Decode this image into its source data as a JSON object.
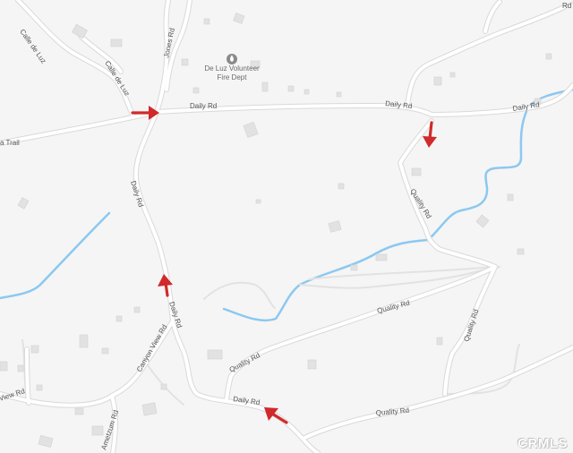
{
  "map": {
    "background": "#f5f5f5",
    "road_color": "#ffffff",
    "water_color": "#8cc8f0",
    "arrow_color": "#d12a2a"
  },
  "labels": {
    "calle_de_luz_1": "Calle de Luz",
    "calle_de_luz_2": "Calle de Luz",
    "jones_rd": "Jones Rd",
    "daily_rd_1": "Daily Rd",
    "daily_rd_2": "Daily Rd",
    "daily_rd_3": "Daily Rd",
    "daily_rd_4": "Daily Rd",
    "daily_rd_5": "Daily Rd",
    "daily_rd_6": "Daily Rd",
    "trail": "a Trail",
    "quality_rd_1": "Quality Rd",
    "quality_rd_2": "Quality Rd",
    "quality_rd_3": "Quality Rd",
    "quality_rd_4": "Quality Rd",
    "quality_rd_5": "Quality Rd",
    "canyon_view_rd_1": "Canyon View Rd",
    "canyon_view_rd_2": "View Rd",
    "ametz_rd": "Ametzum Rd",
    "corner_rd": "Rd"
  },
  "poi": {
    "icon": "fire-station-icon",
    "name_line1": "De Luz Volunteer",
    "name_line2": "Fire Dept"
  },
  "watermark": "CRMLS"
}
